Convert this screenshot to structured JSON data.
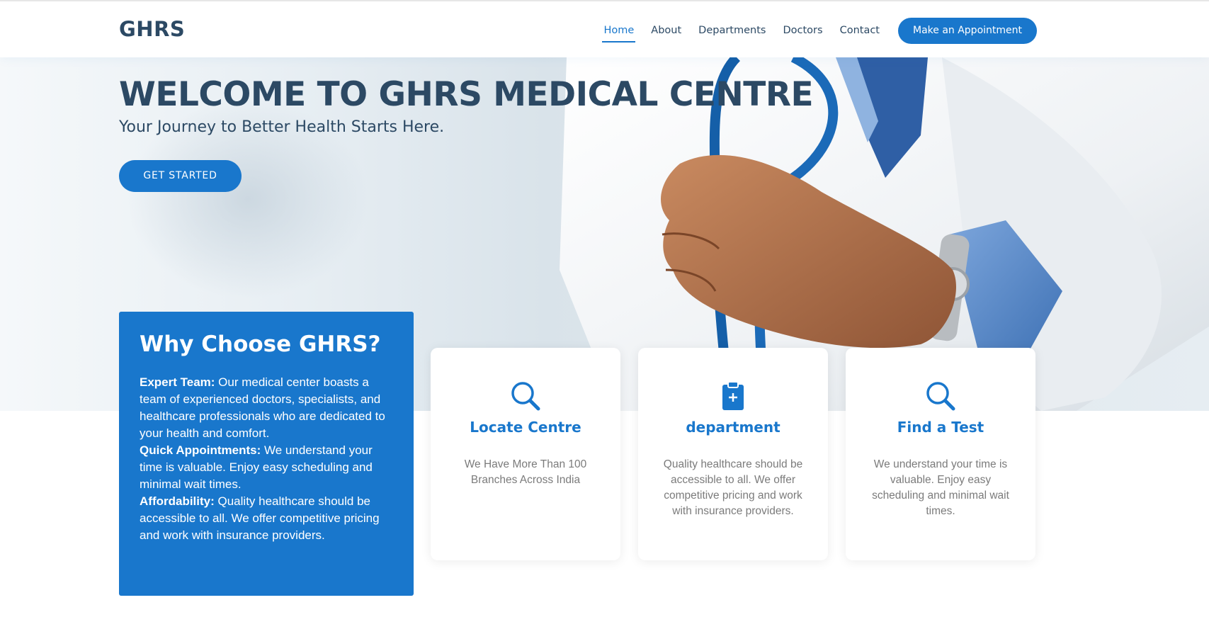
{
  "header": {
    "logo": "GHRS",
    "nav": [
      "Home",
      "About",
      "Departments",
      "Doctors",
      "Contact"
    ],
    "active_nav": "Home",
    "appointment_label": "Make an Appointment"
  },
  "hero": {
    "title": "WELCOME TO GHRS MEDICAL CENTRE",
    "subtitle": "Your Journey to Better Health Starts Here.",
    "cta_label": "GET STARTED"
  },
  "why": {
    "title": "Why Choose GHRS?",
    "points": [
      {
        "label": "Expert Team:",
        "text": " Our medical center boasts a team of experienced doctors, specialists, and healthcare professionals who are dedicated to your health and comfort."
      },
      {
        "label": "Quick Appointments:",
        "text": " We understand your time is valuable. Enjoy easy scheduling and minimal wait times."
      },
      {
        "label": "Affordability:",
        "text": " Quality healthcare should be accessible to all. We offer competitive pricing and work with insurance providers."
      }
    ]
  },
  "cards": [
    {
      "icon": "search-icon",
      "title": "Locate Centre",
      "text": "We Have More Than 100 Branches Across India"
    },
    {
      "icon": "clipboard-plus-icon",
      "title": "department",
      "text": "Quality healthcare should be accessible to all. We offer competitive pricing and work with insurance providers."
    },
    {
      "icon": "search-icon",
      "title": "Find a Test",
      "text": "We understand your time is valuable. Enjoy easy scheduling and minimal wait times."
    }
  ],
  "colors": {
    "primary": "#1977cc",
    "heading": "#2c4964",
    "muted_text": "#7b7b7b"
  }
}
